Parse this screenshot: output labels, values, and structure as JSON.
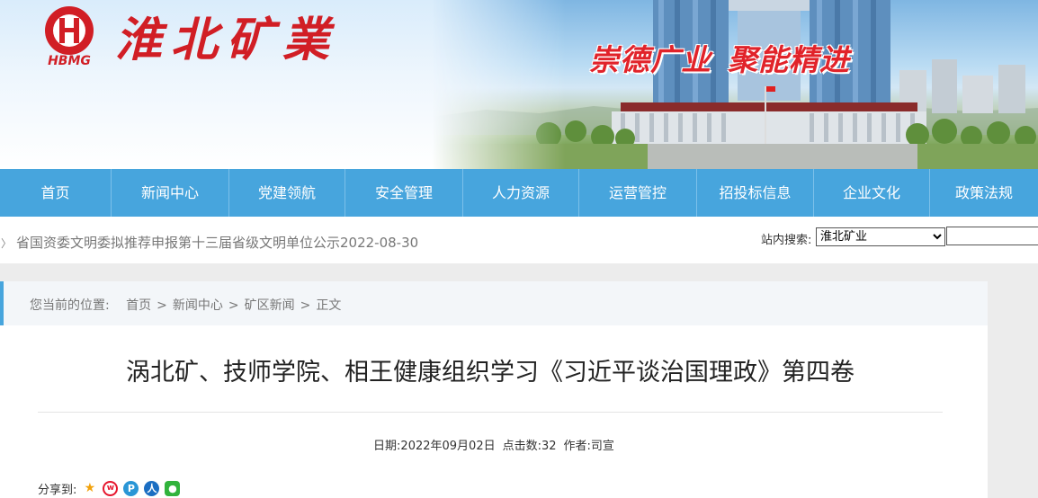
{
  "header": {
    "logo_text": "HBMG",
    "site_name": "淮北矿業",
    "slogan": [
      "崇德广业",
      "聚能精进"
    ]
  },
  "nav": {
    "items": [
      {
        "label": "首页",
        "name": "nav-item-home"
      },
      {
        "label": "新闻中心",
        "name": "nav-item-news"
      },
      {
        "label": "党建领航",
        "name": "nav-item-party"
      },
      {
        "label": "安全管理",
        "name": "nav-item-safety"
      },
      {
        "label": "人力资源",
        "name": "nav-item-hr"
      },
      {
        "label": "运营管控",
        "name": "nav-item-operations"
      },
      {
        "label": "招投标信息",
        "name": "nav-item-bidding"
      },
      {
        "label": "企业文化",
        "name": "nav-item-culture"
      },
      {
        "label": "政策法规",
        "name": "nav-item-policy"
      }
    ]
  },
  "notice": {
    "text": "省国资委文明委拟推荐申报第十三届省级文明单位公示2022-08-30"
  },
  "search": {
    "label": "站内搜索:",
    "selected": "淮北矿业"
  },
  "breadcrumb": {
    "prefix": "您当前的位置:",
    "items": [
      "首页",
      "新闻中心",
      "矿区新闻",
      "正文"
    ],
    "separator": ">"
  },
  "article": {
    "title": "涡北矿、技师学院、相王健康组织学习《习近平谈治国理政》第四卷",
    "date": "日期:2022年09月02日",
    "clicks": "点击数:32",
    "author": "作者:司宣"
  },
  "share": {
    "label": "分享到:",
    "icons": [
      "qzone-icon",
      "weibo-icon",
      "pinterest-icon",
      "renren-icon",
      "wechat-icon"
    ]
  },
  "colors": {
    "nav_bg": "#47a5dd",
    "brand_red": "#d11e25"
  }
}
